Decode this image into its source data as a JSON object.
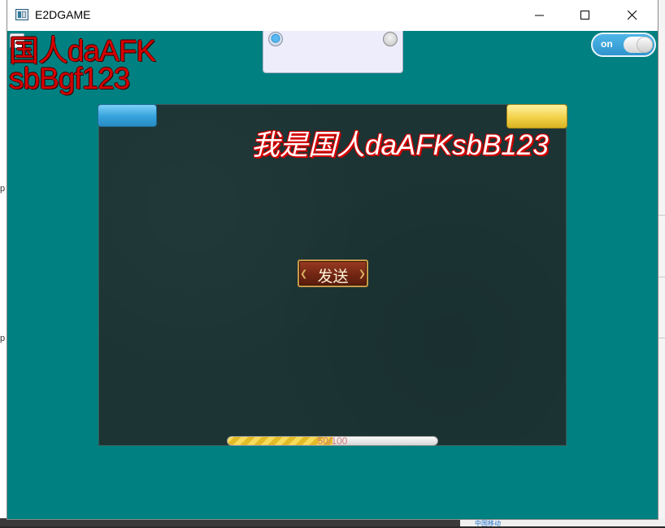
{
  "window": {
    "title": "E2DGAME"
  },
  "overlay": {
    "line1": "国人daAFK",
    "line2": "sbBgf123"
  },
  "toggle": {
    "label": "on",
    "state": "on"
  },
  "radios": [
    {
      "selected": true
    },
    {
      "selected": false
    }
  ],
  "italic_label": "我是国人daAFKsbB123",
  "send_button": {
    "label": "发送"
  },
  "progress": {
    "value": 50,
    "max": 100,
    "label_value": "50",
    "label_sep": "/",
    "label_max": "100"
  },
  "desktop": {
    "mark": "p",
    "carrier": "中国移动"
  },
  "colors": {
    "client_bg": "#008080",
    "panel_bg": "#1c3434",
    "red_text": "#d40000"
  }
}
